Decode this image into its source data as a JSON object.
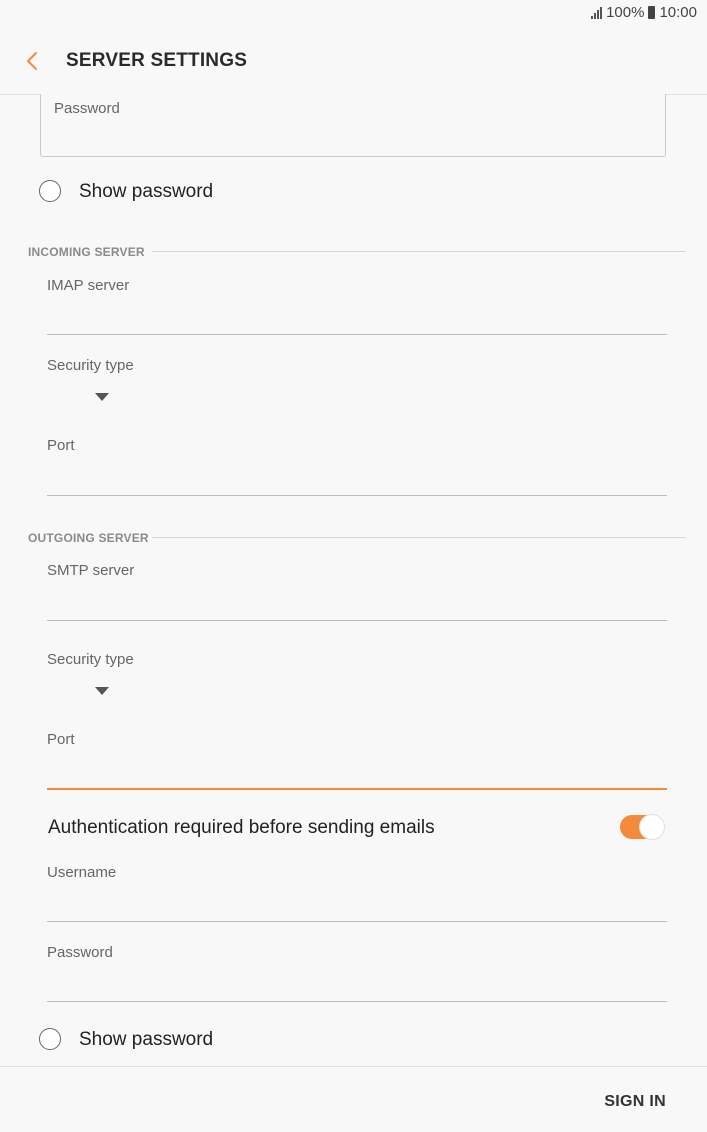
{
  "status_bar": {
    "battery": "100%",
    "time": "10:00"
  },
  "app_bar": {
    "title": "SERVER SETTINGS"
  },
  "account": {
    "password_label": "Password",
    "show_password_label": "Show password"
  },
  "incoming": {
    "section_title": "INCOMING SERVER",
    "server_label": "IMAP server",
    "server_value": "",
    "security_label": "Security type",
    "security_value": "",
    "port_label": "Port",
    "port_value": ""
  },
  "outgoing": {
    "section_title": "OUTGOING SERVER",
    "server_label": "SMTP server",
    "server_value": "",
    "security_label": "Security type",
    "security_value": "",
    "port_label": "Port",
    "port_value": "",
    "auth_label": "Authentication required before sending emails",
    "auth_enabled": true,
    "username_label": "Username",
    "password_label": "Password",
    "show_password_label": "Show password"
  },
  "footer": {
    "sign_in_label": "SIGN IN"
  },
  "colors": {
    "accent": "#f58a3c",
    "background": "#f8f8f8"
  }
}
